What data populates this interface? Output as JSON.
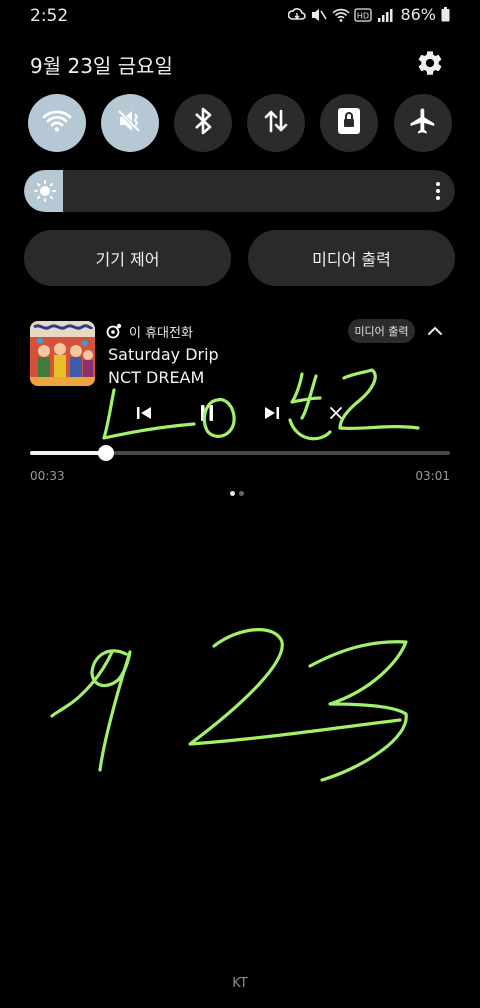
{
  "status_bar": {
    "time": "2:52",
    "battery": "86%",
    "icons": [
      "cloud-sync-icon",
      "mute-icon",
      "wifi-icon",
      "hd-voice-icon",
      "signal-icon",
      "battery-icon"
    ]
  },
  "header": {
    "date": "9월 23일 금요일",
    "settings_icon": "gear-icon"
  },
  "quick_tiles": [
    {
      "name": "wifi",
      "icon": "wifi-icon",
      "active": true
    },
    {
      "name": "sound",
      "icon": "mute-icon",
      "active": true
    },
    {
      "name": "bluetooth",
      "icon": "bluetooth-icon",
      "active": false
    },
    {
      "name": "mobile-data",
      "icon": "data-transfer-icon",
      "active": false
    },
    {
      "name": "screen-lock",
      "icon": "lock-icon",
      "active": false
    },
    {
      "name": "airplane-mode",
      "icon": "airplane-icon",
      "active": false
    }
  ],
  "brightness": {
    "level": 0.09
  },
  "buttons": {
    "device_control": "기기 제어",
    "media_output": "미디어 출력"
  },
  "media": {
    "source": "이 휴대전화",
    "output_chip": "미디어 출력",
    "title": "Saturday Drip",
    "artist": "NCT DREAM",
    "elapsed": "00:33",
    "duration": "03:01",
    "progress": 0.18,
    "page_count": 2,
    "active_page": 0
  },
  "colors": {
    "accent": "#b6c8d4",
    "handwriting": "#a3f06a"
  },
  "footer": {
    "carrier": "KT"
  }
}
